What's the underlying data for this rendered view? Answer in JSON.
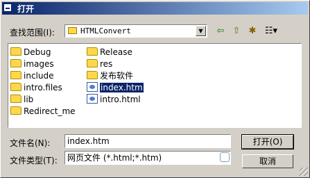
{
  "dialog": {
    "title": "打开"
  },
  "lookin": {
    "label": "查找范围(I):",
    "value": "HTMLConvert"
  },
  "toolbar": {
    "back_glyph": "⇦",
    "up_glyph": "⇧",
    "newfolder_glyph": "✱",
    "views_glyph": "☷▾"
  },
  "files": [
    {
      "name": "Debug",
      "icon": "folder-icon"
    },
    {
      "name": "images",
      "icon": "folder-icon"
    },
    {
      "name": "include",
      "icon": "folder-icon"
    },
    {
      "name": "intro.files",
      "icon": "folder-icon"
    },
    {
      "name": "lib",
      "icon": "folder-icon"
    },
    {
      "name": "Redirect_me",
      "icon": "folder-icon"
    },
    {
      "name": "Release",
      "icon": "folder-icon"
    },
    {
      "name": "res",
      "icon": "folder-icon"
    },
    {
      "name": "发布软件",
      "icon": "folder-icon"
    },
    {
      "name": "index.htm",
      "icon": "html-file-icon",
      "selected": true
    },
    {
      "name": "intro.html",
      "icon": "html-file-icon"
    }
  ],
  "filename": {
    "label": "文件名(N):",
    "value": "index.htm"
  },
  "filetype": {
    "label": "文件类型(T):",
    "value": "网页文件 (*.html;*.htm)"
  },
  "buttons": {
    "open": "打开(O)",
    "cancel": "取消"
  }
}
